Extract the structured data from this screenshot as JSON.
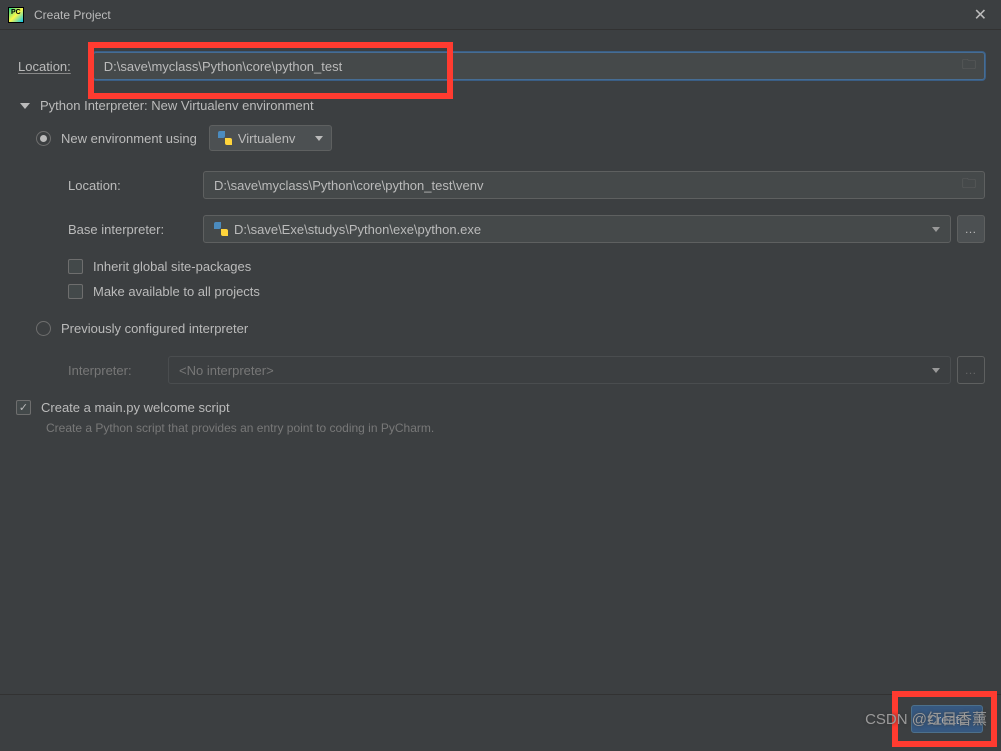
{
  "window": {
    "title": "Create Project"
  },
  "main": {
    "location_label": "Location:",
    "location_value": "D:\\save\\myclass\\Python\\core\\python_test"
  },
  "interpreter_section": {
    "title": "Python Interpreter: New Virtualenv environment",
    "new_env": {
      "label": "New environment using",
      "tool": "Virtualenv",
      "location_label": "Location:",
      "location_value": "D:\\save\\myclass\\Python\\core\\python_test\\venv",
      "base_label": "Base interpreter:",
      "base_value": "D:\\save\\Exe\\studys\\Python\\exe\\python.exe",
      "inherit_label": "Inherit global site-packages",
      "available_label": "Make available to all projects"
    },
    "prev_env": {
      "label": "Previously configured interpreter",
      "interpreter_label": "Interpreter:",
      "interpreter_value": "<No interpreter>"
    }
  },
  "welcome": {
    "label": "Create a main.py welcome script",
    "helper": "Create a Python script that provides an entry point to coding in PyCharm."
  },
  "footer": {
    "create_button": "Create"
  },
  "watermark": "CSDN @红目香薰"
}
